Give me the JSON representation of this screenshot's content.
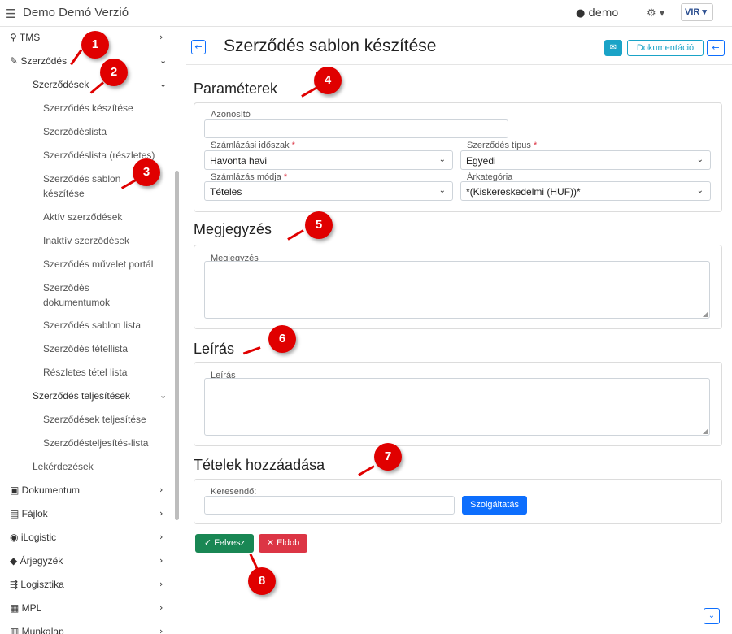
{
  "app": {
    "title": "Demo Demó Verzió",
    "user": "demo",
    "logo_text": "VIR"
  },
  "sidebar": {
    "tms": "TMS",
    "szerzodes": "Szerződés",
    "szerzodesek": "Szerződések",
    "sub_items": [
      "Szerződés készítése",
      "Szerződéslista",
      "Szerződéslista (részletes)",
      "Szerződés sablon",
      "készítése",
      "Aktív szerződések",
      "Inaktív szerződések",
      "Szerződés művelet portál",
      "Szerződés",
      "dokumentumok",
      "Szerződés sablon lista",
      "Szerződés tétellista",
      "Részletes tétel lista"
    ],
    "teljesitesek": "Szerződés teljesítések",
    "telj_items": [
      "Szerződések teljesítése",
      "Szerződésteljesítés-lista"
    ],
    "lekerdezesek": "Lekérdezések",
    "bottom_items": [
      "Dokumentum",
      "Fájlok",
      "iLogistic",
      "Árjegyzék",
      "Logisztika",
      "MPL",
      "Munkalap"
    ]
  },
  "header": {
    "title": "Szerződés sablon készítése",
    "doc_button": "Dokumentáció"
  },
  "sections": {
    "parameters": "Paraméterek",
    "note": "Megjegyzés",
    "description": "Leírás",
    "items": "Tételek hozzáadása"
  },
  "form": {
    "azonosito_label": "Azonosító",
    "azonosito_value": "",
    "szamlazasi_idoszak_label": "Számlázási időszak",
    "szamlazasi_idoszak_value": "Havonta havi",
    "szerzodes_tipus_label": "Szerződés típus",
    "szerzodes_tipus_value": "Egyedi",
    "szamlazas_modja_label": "Számlázás módja",
    "szamlazas_modja_value": "Tételes",
    "arkategoria_label": "Árkategória",
    "arkategoria_value": "*(Kiskereskedelmi (HUF))*",
    "megjegyzes_label": "Megjegyzés",
    "leiras_label": "Leírás",
    "keresendo_label": "Keresendő:",
    "service_button": "Szolgáltatás"
  },
  "actions": {
    "save": "Felvesz",
    "discard": "Eldob"
  },
  "callouts": [
    "1",
    "2",
    "3",
    "4",
    "5",
    "6",
    "7",
    "8"
  ],
  "colors": {
    "callout": "#e00000",
    "primary": "#0d6efd",
    "info": "#1aa3c7",
    "success": "#198754",
    "danger": "#dc3545"
  }
}
